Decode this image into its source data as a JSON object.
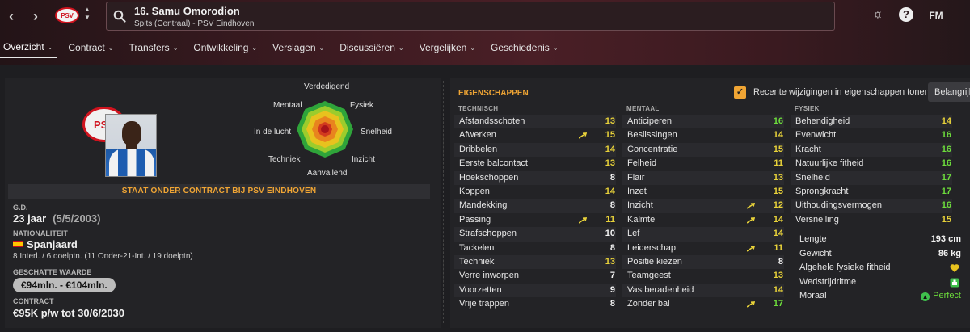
{
  "header": {
    "title": "16. Samu Omorodion",
    "subtitle": "Spits (Centraal) - PSV Eindhoven",
    "badge_text": "PSV",
    "fm_label": "FM",
    "help_label": "?"
  },
  "tabs": [
    {
      "label": "Overzicht",
      "active": true
    },
    {
      "label": "Contract"
    },
    {
      "label": "Transfers"
    },
    {
      "label": "Ontwikkeling"
    },
    {
      "label": "Verslagen"
    },
    {
      "label": "Discussiëren"
    },
    {
      "label": "Vergelijken"
    },
    {
      "label": "Geschiedenis"
    }
  ],
  "radar": {
    "labels": [
      "Verdedigend",
      "Fysiek",
      "Snelheid",
      "Inzicht",
      "Aanvallend",
      "Techniek",
      "In de lucht",
      "Mentaal"
    ]
  },
  "profile": {
    "badge_text": "PSV",
    "contract_banner": "STAAT ONDER CONTRACT BIJ PSV EINDHOVEN",
    "gd_label": "G.D.",
    "age": "23 jaar",
    "dob": "(5/5/2003)",
    "nationality_label": "NATIONALITEIT",
    "nationality": "Spanjaard",
    "caps": "8 Interl. / 6 doelptn. (11 Onder-21-Int. / 19 doelptn)",
    "value_label": "GESCHATTE WAARDE",
    "value": "€94mln. - €104mln.",
    "contract_label": "CONTRACT",
    "contract": "€95K p/w tot 30/6/2030"
  },
  "attributes": {
    "title": "EIGENSCHAPPEN",
    "recent_changes_label": "Recente wijzigingen in eigenschappen tonen",
    "recent_changes_checked": true,
    "view_button": "Belangrijk",
    "technical_header": "TECHNISCH",
    "mental_header": "MENTAAL",
    "physical_header": "FYSIEK",
    "technical": [
      {
        "name": "Afstandsschoten",
        "value": 13,
        "arrow": false
      },
      {
        "name": "Afwerken",
        "value": 15,
        "arrow": true
      },
      {
        "name": "Dribbelen",
        "value": 14,
        "arrow": false
      },
      {
        "name": "Eerste balcontact",
        "value": 13,
        "arrow": false
      },
      {
        "name": "Hoekschoppen",
        "value": 8,
        "arrow": false
      },
      {
        "name": "Koppen",
        "value": 14,
        "arrow": false
      },
      {
        "name": "Mandekking",
        "value": 8,
        "arrow": false
      },
      {
        "name": "Passing",
        "value": 11,
        "arrow": true
      },
      {
        "name": "Strafschoppen",
        "value": 10,
        "arrow": false
      },
      {
        "name": "Tackelen",
        "value": 8,
        "arrow": false
      },
      {
        "name": "Techniek",
        "value": 13,
        "arrow": false
      },
      {
        "name": "Verre inworpen",
        "value": 7,
        "arrow": false
      },
      {
        "name": "Voorzetten",
        "value": 9,
        "arrow": false
      },
      {
        "name": "Vrije trappen",
        "value": 8,
        "arrow": false
      }
    ],
    "mental": [
      {
        "name": "Anticiperen",
        "value": 16,
        "arrow": false
      },
      {
        "name": "Beslissingen",
        "value": 14,
        "arrow": false
      },
      {
        "name": "Concentratie",
        "value": 15,
        "arrow": false
      },
      {
        "name": "Felheid",
        "value": 11,
        "arrow": false
      },
      {
        "name": "Flair",
        "value": 13,
        "arrow": false
      },
      {
        "name": "Inzet",
        "value": 15,
        "arrow": false
      },
      {
        "name": "Inzicht",
        "value": 12,
        "arrow": true
      },
      {
        "name": "Kalmte",
        "value": 14,
        "arrow": true
      },
      {
        "name": "Lef",
        "value": 14,
        "arrow": false
      },
      {
        "name": "Leiderschap",
        "value": 11,
        "arrow": true
      },
      {
        "name": "Positie kiezen",
        "value": 8,
        "arrow": false
      },
      {
        "name": "Teamgeest",
        "value": 13,
        "arrow": false
      },
      {
        "name": "Vastberadenheid",
        "value": 14,
        "arrow": false
      },
      {
        "name": "Zonder bal",
        "value": 17,
        "arrow": true
      }
    ],
    "physical": [
      {
        "name": "Behendigheid",
        "value": 14,
        "arrow": false
      },
      {
        "name": "Evenwicht",
        "value": 16,
        "arrow": false
      },
      {
        "name": "Kracht",
        "value": 16,
        "arrow": false
      },
      {
        "name": "Natuurlijke fitheid",
        "value": 16,
        "arrow": false
      },
      {
        "name": "Snelheid",
        "value": 17,
        "arrow": false
      },
      {
        "name": "Sprongkracht",
        "value": 17,
        "arrow": false
      },
      {
        "name": "Uithoudingsvermogen",
        "value": 16,
        "arrow": false
      },
      {
        "name": "Versnelling",
        "value": 15,
        "arrow": false
      }
    ],
    "info": {
      "length_label": "Lengte",
      "length": "193 cm",
      "weight_label": "Gewicht",
      "weight": "86 kg",
      "fitness_label": "Algehele fysieke fitheid",
      "match_fitness_label": "Wedstrijdritme",
      "morale_label": "Moraal",
      "morale": "Perfect"
    }
  },
  "colors": {
    "accent": "#f0a534",
    "value_white": "#f2f2f2",
    "value_yellow": "#e8d23a",
    "value_green": "#6ddc3c"
  }
}
